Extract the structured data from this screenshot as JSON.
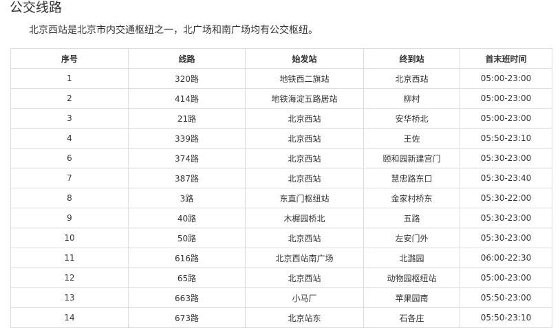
{
  "section": {
    "title": "公交线路",
    "intro": "北京西站是北京市内交通枢纽之一，北广场和南广场均有公交枢纽。"
  },
  "table": {
    "headers": [
      "序号",
      "线路",
      "始发站",
      "终到站",
      "首末班时间"
    ],
    "rows": [
      [
        "1",
        "320路",
        "地铁西二旗站",
        "北京西站",
        "05:00-23:00"
      ],
      [
        "2",
        "414路",
        "地铁海淀五路居站",
        "柳村",
        "05:00-23:00"
      ],
      [
        "3",
        "21路",
        "北京西站",
        "安华桥北",
        "05:00-23:00"
      ],
      [
        "4",
        "339路",
        "北京西站",
        "王佐",
        "05:50-23:10"
      ],
      [
        "6",
        "374路",
        "北京西站",
        "颐和园新建宫门",
        "05:30-23:00"
      ],
      [
        "7",
        "387路",
        "北京西站",
        "慧忠路东口",
        "05:30-23:40"
      ],
      [
        "8",
        "3路",
        "东直门枢纽站",
        "金家村桥东",
        "05:30-22:00"
      ],
      [
        "9",
        "40路",
        "木樨园桥北",
        "五路",
        "05:30-23:00"
      ],
      [
        "10",
        "50路",
        "北京西站",
        "左安门外",
        "05:30-23:00"
      ],
      [
        "11",
        "616路",
        "北京西站南广场",
        "北潞园",
        "06:00-22:30"
      ],
      [
        "12",
        "65路",
        "北京西站",
        "动物园枢纽站",
        "05:00-23:00"
      ],
      [
        "13",
        "663路",
        "小马厂",
        "苹果园南",
        "05:50-23:00"
      ],
      [
        "14",
        "673路",
        "北京站东",
        "石各庄",
        "05:50-23:10"
      ]
    ]
  }
}
